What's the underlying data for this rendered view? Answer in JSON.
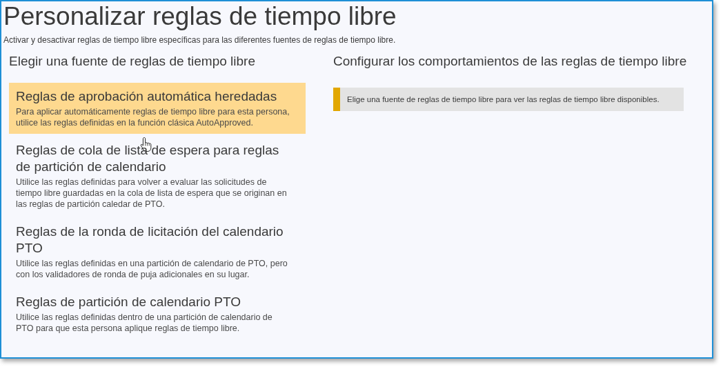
{
  "page": {
    "title": "Personalizar reglas de tiempo libre",
    "subtitle": "Activar y desactivar reglas de tiempo libre específicas para las diferentes fuentes de reglas de tiempo libre."
  },
  "sources": {
    "heading": "Elegir una fuente de reglas de tiempo libre",
    "items": [
      {
        "title": "Reglas de aprobación automática heredadas",
        "description": "Para aplicar automáticamente reglas de tiempo libre para esta persona, utilice las reglas definidas en la función clásica AutoApproved.",
        "selected": true
      },
      {
        "title": "Reglas de cola de lista de espera para reglas de partición de calendario",
        "description": "Utilice las reglas definidas para volver a evaluar las solicitudes de tiempo libre guardadas en la cola de lista de espera que se originan en las reglas de partición caledar de PTO.",
        "selected": false
      },
      {
        "title": "Reglas de la ronda de licitación del calendario PTO",
        "description": "Utilice las reglas definidas en una partición de calendario de PTO, pero con los validadores de ronda de puja adicionales en su lugar.",
        "selected": false
      },
      {
        "title": "Reglas de partición de calendario PTO",
        "description": "Utilice las reglas definidas dentro de una partición de calendario de PTO para que esta persona aplique reglas de tiempo libre.",
        "selected": false
      }
    ]
  },
  "behaviors": {
    "heading": "Configurar los comportamientos de las reglas de tiempo libre",
    "notice": "Elige una fuente de reglas de tiempo libre para ver las reglas de tiempo libre disponibles."
  }
}
